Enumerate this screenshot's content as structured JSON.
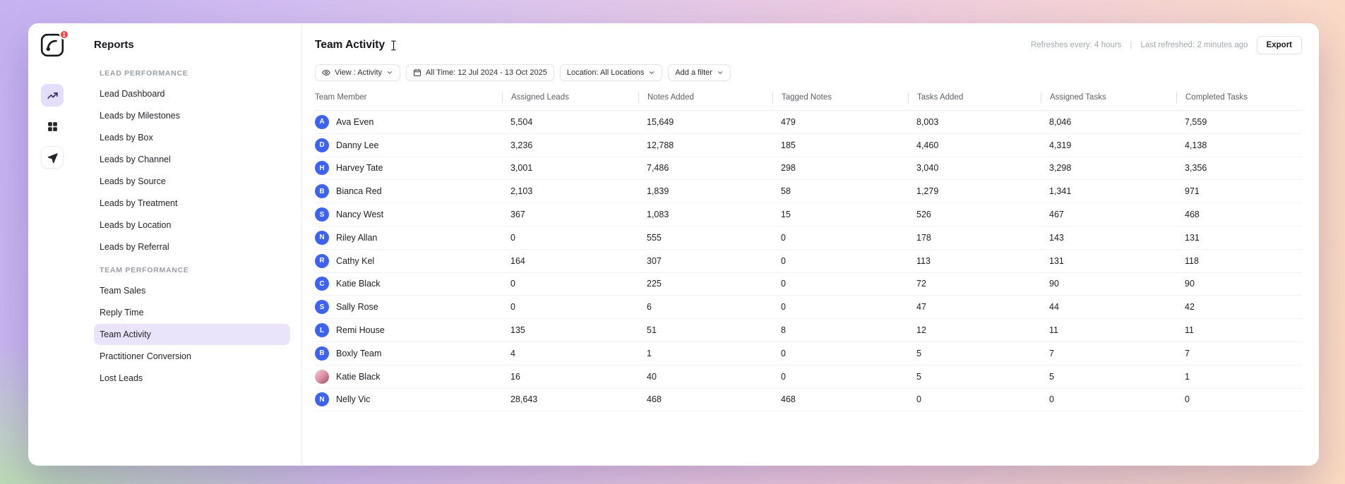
{
  "rail": {
    "logo_badge": "1",
    "items": [
      {
        "name": "reports",
        "icon": "trend-chart-icon",
        "active": true,
        "boxed": false
      },
      {
        "name": "apps",
        "icon": "grid-icon",
        "active": false,
        "boxed": false
      },
      {
        "name": "share",
        "icon": "paper-plane-icon",
        "active": false,
        "boxed": true
      }
    ]
  },
  "sidebar": {
    "title": "Reports",
    "sections": [
      {
        "header": "LEAD PERFORMANCE",
        "items": [
          {
            "label": "Lead Dashboard",
            "active": false
          },
          {
            "label": "Leads by Milestones",
            "active": false
          },
          {
            "label": "Leads by Box",
            "active": false
          },
          {
            "label": "Leads by Channel",
            "active": false
          },
          {
            "label": "Leads by Source",
            "active": false
          },
          {
            "label": "Leads by Treatment",
            "active": false
          },
          {
            "label": "Leads by Location",
            "active": false
          },
          {
            "label": "Leads by Referral",
            "active": false
          }
        ]
      },
      {
        "header": "TEAM PERFORMANCE",
        "items": [
          {
            "label": "Team Sales",
            "active": false
          },
          {
            "label": "Reply Time",
            "active": false
          },
          {
            "label": "Team Activity",
            "active": true
          },
          {
            "label": "Practitioner Conversion",
            "active": false
          },
          {
            "label": "Lost Leads",
            "active": false
          }
        ]
      }
    ]
  },
  "header": {
    "title": "Team Activity",
    "refresh_info": "Refreshes every: 4 hours",
    "divider": "|",
    "last_refreshed": "Last refreshed: 2 minutes ago",
    "export_label": "Export"
  },
  "filters": [
    {
      "label": "View : Activity",
      "icon": "eye-icon",
      "chevron": true
    },
    {
      "label": "All Time: 12 Jul 2024 - 13 Oct 2025",
      "icon": "calendar-icon",
      "chevron": false
    },
    {
      "label": "Location: All Locations",
      "icon": null,
      "chevron": true
    },
    {
      "label": "Add a filter",
      "icon": null,
      "chevron": true
    }
  ],
  "table": {
    "columns": [
      "Team Member",
      "Assigned Leads",
      "Notes Added",
      "Tagged Notes",
      "Tasks Added",
      "Assigned Tasks",
      "Completed Tasks"
    ],
    "avatar_color": "#3E63F4",
    "rows": [
      {
        "initial": "A",
        "name": "Ava Even",
        "photo": false,
        "values": [
          "5,504",
          "15,649",
          "479",
          "8,003",
          "8,046",
          "7,559"
        ]
      },
      {
        "initial": "D",
        "name": "Danny Lee",
        "photo": false,
        "values": [
          "3,236",
          "12,788",
          "185",
          "4,460",
          "4,319",
          "4,138"
        ]
      },
      {
        "initial": "H",
        "name": "Harvey Tate",
        "photo": false,
        "values": [
          "3,001",
          "7,486",
          "298",
          "3,040",
          "3,298",
          "3,356"
        ]
      },
      {
        "initial": "B",
        "name": "Bianca Red",
        "photo": false,
        "values": [
          "2,103",
          "1,839",
          "58",
          "1,279",
          "1,341",
          "971"
        ]
      },
      {
        "initial": "S",
        "name": "Nancy West",
        "photo": false,
        "values": [
          "367",
          "1,083",
          "15",
          "526",
          "467",
          "468"
        ]
      },
      {
        "initial": "N",
        "name": "Riley Allan",
        "photo": false,
        "values": [
          "0",
          "555",
          "0",
          "178",
          "143",
          "131"
        ]
      },
      {
        "initial": "R",
        "name": "Cathy Kel",
        "photo": false,
        "values": [
          "164",
          "307",
          "0",
          "113",
          "131",
          "118"
        ]
      },
      {
        "initial": "C",
        "name": "Katie Black",
        "photo": false,
        "values": [
          "0",
          "225",
          "0",
          "72",
          "90",
          "90"
        ]
      },
      {
        "initial": "S",
        "name": "Sally Rose",
        "photo": false,
        "values": [
          "0",
          "6",
          "0",
          "47",
          "44",
          "42"
        ]
      },
      {
        "initial": "L",
        "name": "Remi House",
        "photo": false,
        "values": [
          "135",
          "51",
          "8",
          "12",
          "11",
          "11"
        ]
      },
      {
        "initial": "B",
        "name": "Boxly Team",
        "photo": false,
        "values": [
          "4",
          "1",
          "0",
          "5",
          "7",
          "7"
        ]
      },
      {
        "initial": "",
        "name": "Katie Black",
        "photo": true,
        "values": [
          "16",
          "40",
          "0",
          "5",
          "5",
          "1"
        ]
      },
      {
        "initial": "N",
        "name": "Nelly Vic",
        "photo": false,
        "values": [
          "28,643",
          "468",
          "468",
          "0",
          "0",
          "0"
        ]
      }
    ]
  },
  "colors": {
    "accent": "#6D5EF3",
    "active_bg": "#EAE4FB",
    "badge_red": "#EF4444"
  }
}
